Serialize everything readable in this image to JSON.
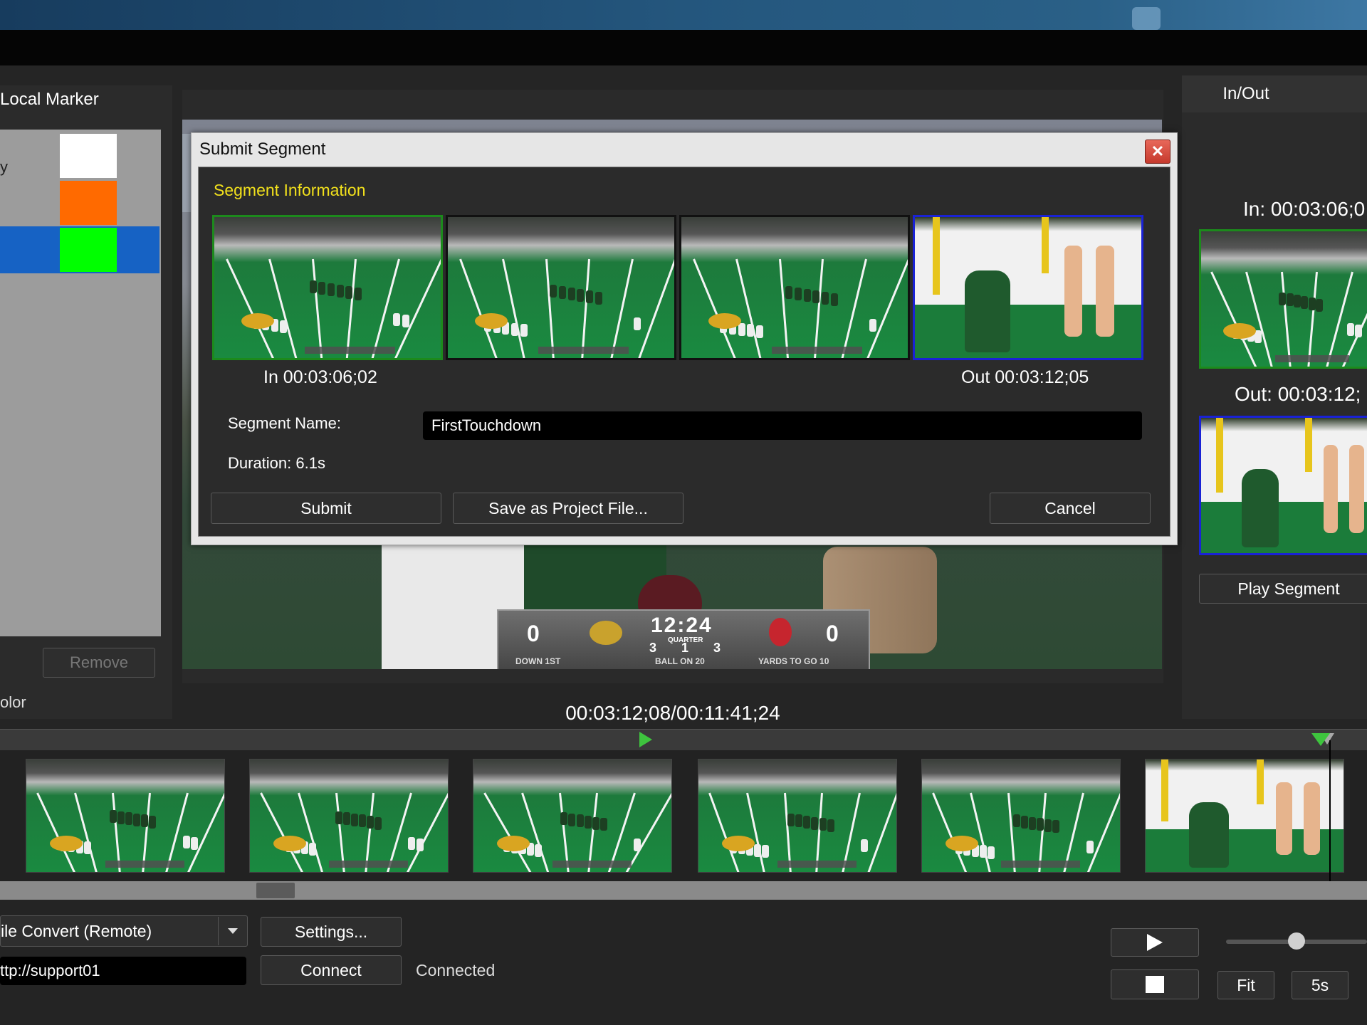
{
  "left_panel": {
    "title": "Local Marker",
    "label_fragment": "y",
    "swatches": [
      {
        "color": "#ffffff"
      },
      {
        "color": "#ff6a00"
      },
      {
        "color": "#00ff00",
        "selected": true
      }
    ],
    "remove_label": "Remove",
    "color_label": "olor"
  },
  "video": {
    "scorebug": {
      "home_score": "0",
      "away_score": "0",
      "clock": "12:24",
      "quarter_label": "QUARTER",
      "tol_left": "3",
      "quarter": "1",
      "tol_right": "3",
      "down": "DOWN 1ST",
      "ball_on": "BALL ON 20",
      "yards_to_go": "YARDS TO GO 10"
    },
    "timecode": "00:03:12;08/00:11:41;24"
  },
  "right_panel": {
    "tab_label": "In/Out",
    "in_label": "In: 00:03:06;0",
    "out_label": "Out: 00:03:12;",
    "play_segment_label": "Play Segment"
  },
  "dialog": {
    "title": "Submit Segment",
    "close_glyph": "✕",
    "section_title": "Segment Information",
    "in_label": "In 00:03:06;02",
    "out_label": "Out 00:03:12;05",
    "segment_name_label": "Segment Name:",
    "segment_name_value": "FirstTouchdown",
    "duration_label": "Duration: 6.1s",
    "submit_label": "Submit",
    "save_project_label": "Save as Project File...",
    "cancel_label": "Cancel"
  },
  "bottom": {
    "mode_value": "ile Convert (Remote)",
    "settings_label": "Settings...",
    "url_value": "ttp://support01",
    "connect_label": "Connect",
    "status": "Connected",
    "fit_label": "Fit",
    "step_label": "5s",
    "zoom_level": 0.5
  }
}
